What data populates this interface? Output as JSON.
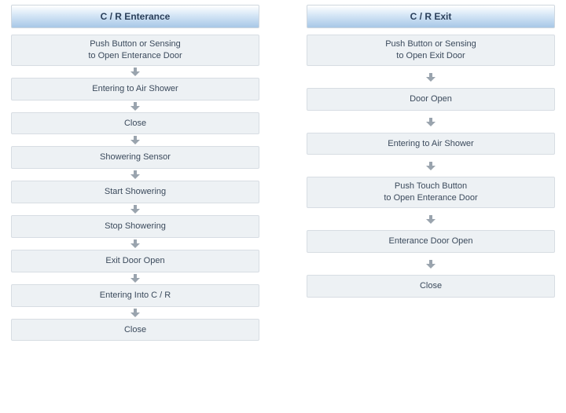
{
  "left": {
    "title": "C / R Enterance",
    "steps": [
      "Push Button or Sensing\nto Open Enterance Door",
      "Entering to Air Shower",
      "Close",
      "Showering Sensor",
      "Start Showering",
      "Stop Showering",
      "Exit Door Open",
      "Entering Into C / R",
      "Close"
    ]
  },
  "right": {
    "title": "C / R Exit",
    "steps": [
      "Push Button or Sensing\nto Open Exit Door",
      "Door Open",
      "Entering to Air Shower",
      "Push Touch Button\nto Open Enterance Door",
      "Enterance Door Open",
      "Close"
    ]
  }
}
